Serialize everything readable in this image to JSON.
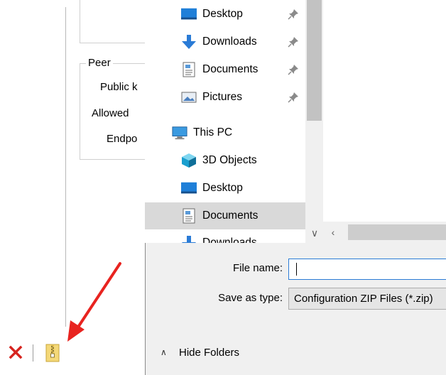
{
  "background_dialog": {
    "peer_group_title": "Peer",
    "public_key_label": "Public k",
    "allowed_ips_label": "Allowed",
    "endpoint_label": "Endpo",
    "delete_icon": "red-x-icon",
    "zip_icon": "zip-file-icon"
  },
  "annotation": {
    "arrow_color": "#e8231f"
  },
  "save_dialog": {
    "nav": {
      "quick_access": [
        {
          "label": "Desktop",
          "icon": "desktop-icon",
          "pinned": true
        },
        {
          "label": "Downloads",
          "icon": "downloads-icon",
          "pinned": true
        },
        {
          "label": "Documents",
          "icon": "documents-icon",
          "pinned": true
        },
        {
          "label": "Pictures",
          "icon": "pictures-icon",
          "pinned": true
        }
      ],
      "this_pc": {
        "label": "This PC",
        "items": [
          {
            "label": "3D Objects",
            "icon": "3d-objects-icon"
          },
          {
            "label": "Desktop",
            "icon": "desktop-icon"
          },
          {
            "label": "Documents",
            "icon": "documents-icon",
            "selected": true
          },
          {
            "label": "Downloads",
            "icon": "downloads-icon"
          }
        ]
      }
    },
    "file_name_label": "File name:",
    "file_name_value": "",
    "save_as_type_label": "Save as type:",
    "save_as_type_value": "Configuration ZIP Files (*.zip)",
    "hide_folders_label": "Hide Folders",
    "colors": {
      "accent": "#2a7bd6",
      "selection": "#d9d9d9"
    }
  }
}
